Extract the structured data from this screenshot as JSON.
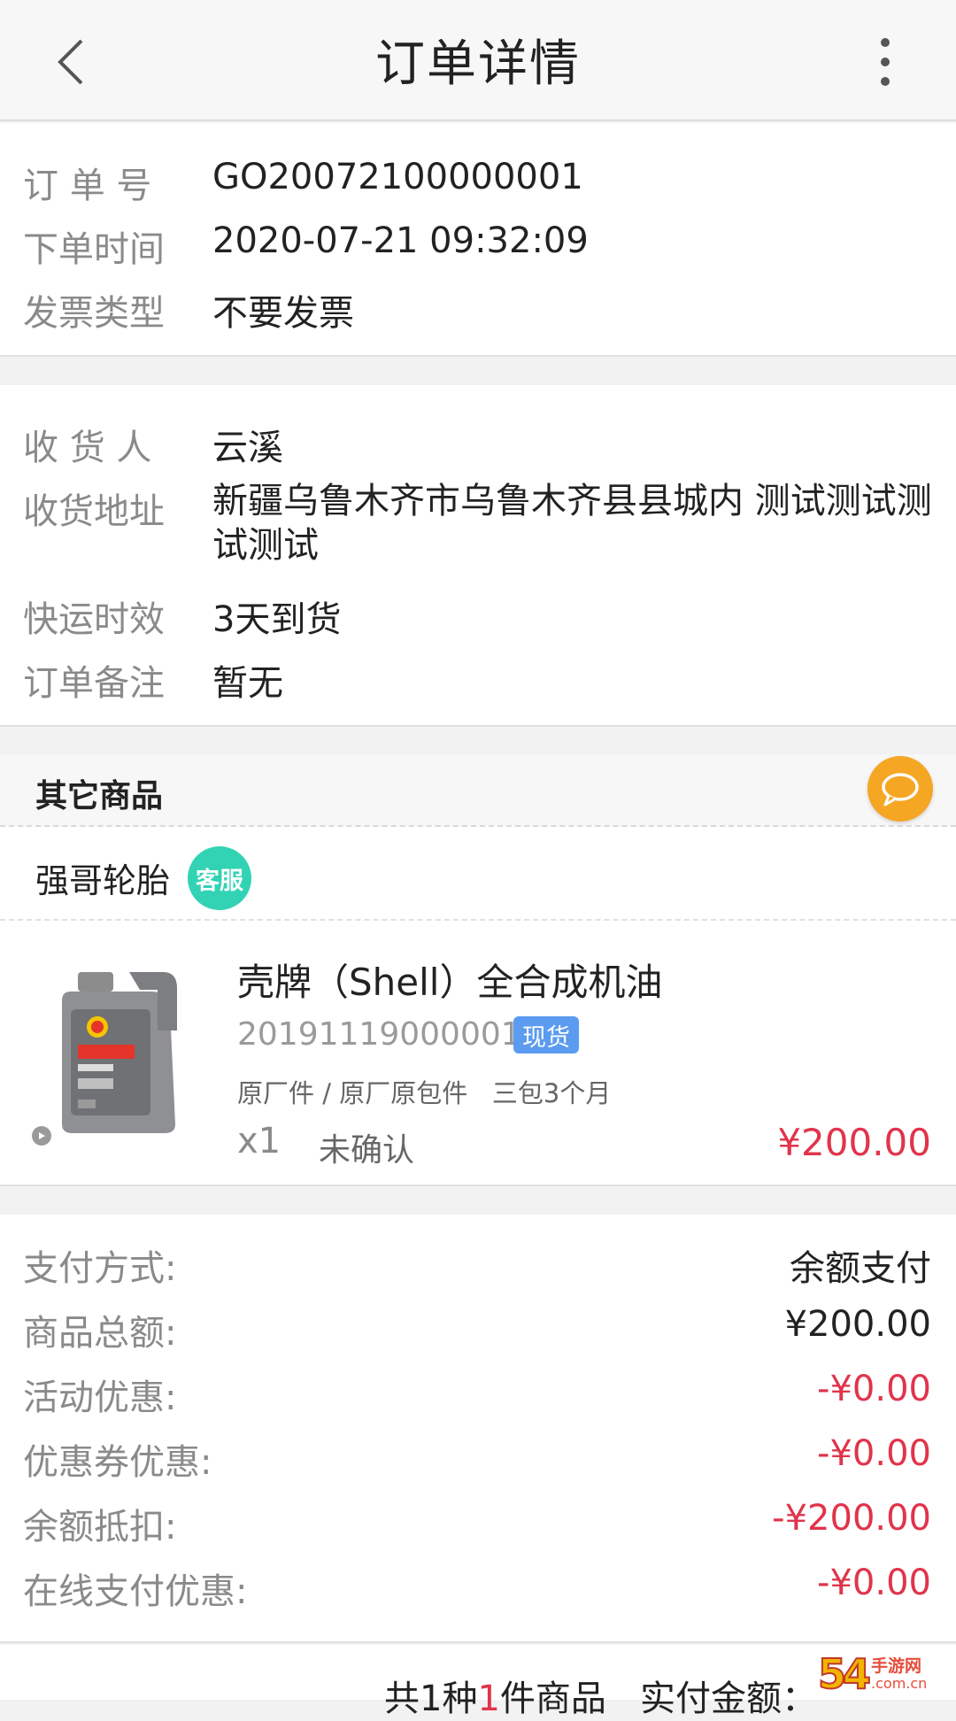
{
  "header": {
    "title": "订单详情"
  },
  "order_info": [
    {
      "label": "订 单 号",
      "value": "GO20072100000001"
    },
    {
      "label": "下单时间",
      "value": "2020-07-21 09:32:09"
    },
    {
      "label": "发票类型",
      "value": "不要发票"
    }
  ],
  "shipping": {
    "receiver_label": "收 货 人",
    "receiver": "云溪",
    "address_label": "收货地址",
    "address": "新疆乌鲁木齐市乌鲁木齐县县城内 测试测试测试测试",
    "delivery_label": "快运时效",
    "delivery": "3天到货",
    "remark_label": "订单备注",
    "remark": "暂无"
  },
  "other_goods": {
    "title": "其它商品"
  },
  "shop": {
    "name": "强哥轮胎",
    "service_label": "客服"
  },
  "product": {
    "name": "壳牌（Shell）全合成机油",
    "code": "20191119000001",
    "stock_tag": "现货",
    "attrs": "原厂件 / 原厂原包件   三包3个月",
    "qty": "x1",
    "status": "未确认",
    "price": "¥200.00"
  },
  "payment": [
    {
      "label": "支付方式:",
      "value": "余额支付",
      "negative": false
    },
    {
      "label": "商品总额:",
      "value": "¥200.00",
      "negative": false
    },
    {
      "label": "活动优惠:",
      "value": "-¥0.00",
      "negative": true
    },
    {
      "label": "优惠券优惠:",
      "value": "-¥0.00",
      "negative": true
    },
    {
      "label": "余额抵扣:",
      "value": "-¥200.00",
      "negative": true
    },
    {
      "label": "在线支付优惠:",
      "value": "-¥0.00",
      "negative": true
    }
  ],
  "summary": {
    "prefix": "共1种",
    "count": "1",
    "suffix": "件商品   实付金额："
  },
  "watermark": {
    "big": "54",
    "line1": "手游网",
    "line2": ".com.cn"
  },
  "colors": {
    "accent_red": "#e0344b",
    "chat_orange": "#f5a623",
    "service_teal": "#31d3b4",
    "stock_blue": "#5b9bf0"
  }
}
